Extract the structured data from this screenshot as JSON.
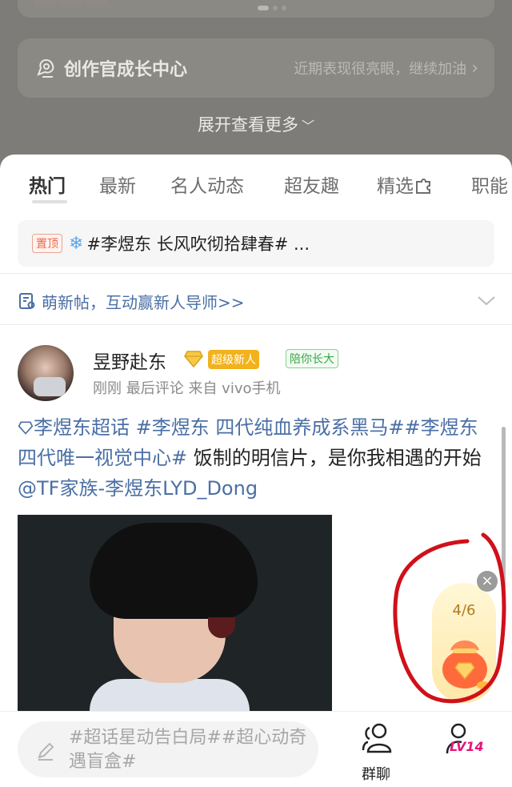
{
  "creator_center": {
    "title": "创作官成长中心",
    "subtitle": "近期表现很亮眼，继续加油"
  },
  "expand_more": "展开查看更多",
  "tabs": [
    "热门",
    "最新",
    "名人动态",
    "超友趣",
    "精选",
    "职能"
  ],
  "pinned": {
    "badge": "置顶",
    "text": "#李煜东 长风吹彻拾肆春# ..."
  },
  "newbie_banner": "萌新帖，互动赢新人导师>>",
  "post": {
    "username": "昱野赴东",
    "badge_super_new": "超级新人",
    "badge_grow": "陪你长大",
    "meta": "刚刚 最后评论  来自 vivo手机",
    "body_tag1": "李煜东超话",
    "body_tag2": "#李煜东 四代纯血养成系黑马##李煜东 四代唯一视觉中心#",
    "body_text": " 饭制的明信片，是你我相遇的开始",
    "body_mention": "@TF家族-李煜东LYD_Dong"
  },
  "reward": {
    "count": "4/6",
    "close": "×"
  },
  "compose_placeholder": "#超话星动告白局##超心动奇遇盲盒#",
  "bottom_nav": {
    "group_label": "群聊",
    "level_label": "LV14"
  },
  "colors": {
    "link": "#4a6fa5",
    "annotation": "#d0101a"
  }
}
